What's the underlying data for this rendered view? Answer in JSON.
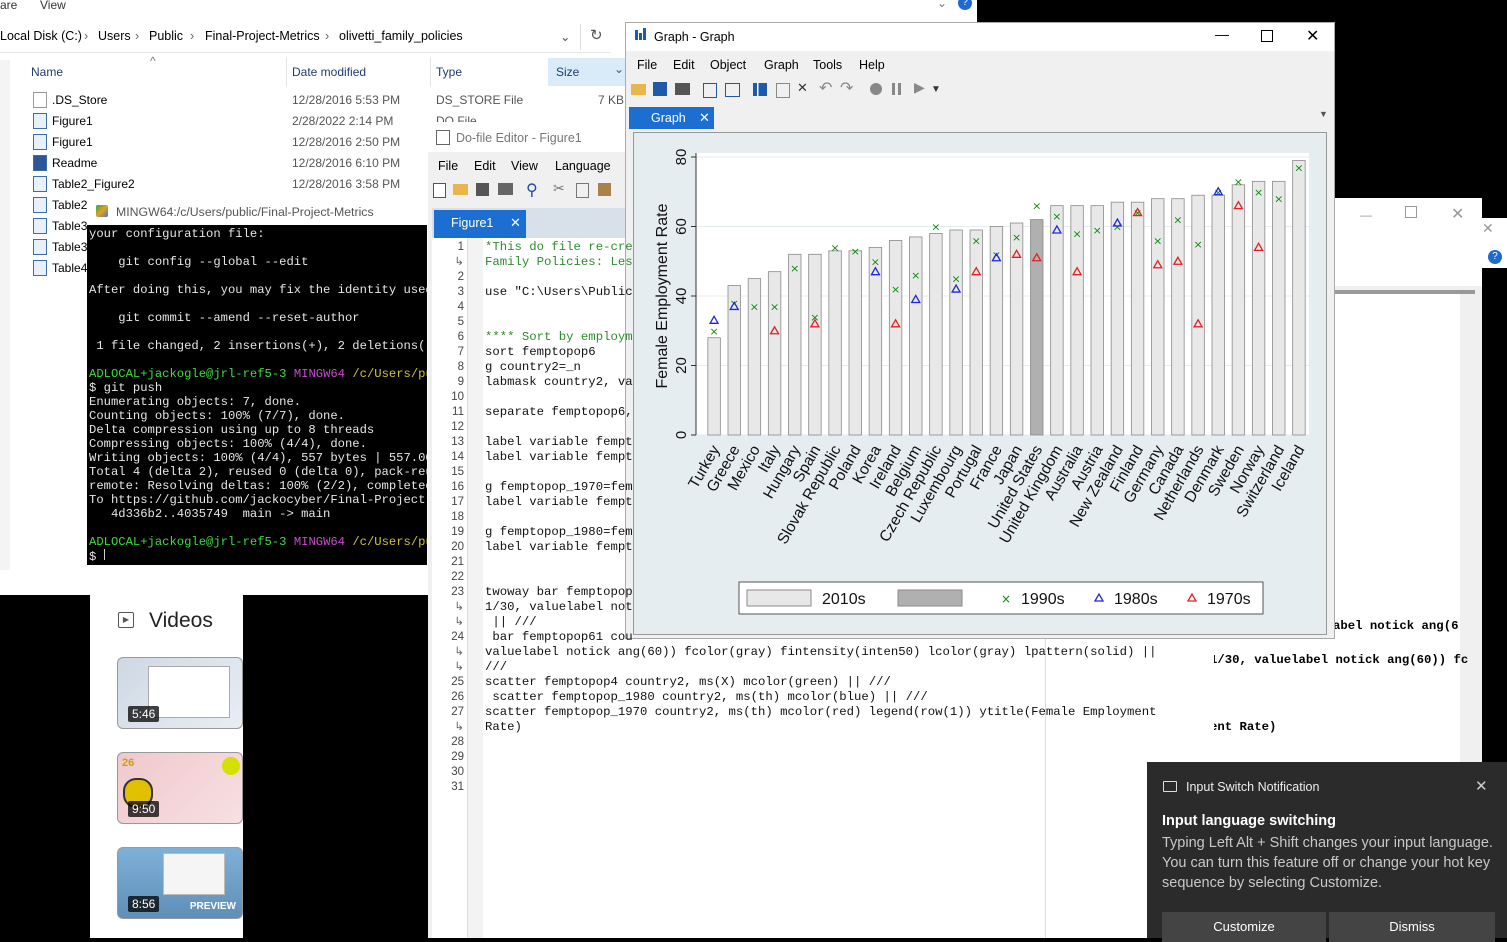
{
  "explorer": {
    "menu": [
      "are",
      "View"
    ],
    "address": [
      "Local Disk (C:)",
      "Users",
      "Public",
      "Final-Project-Metrics",
      "olivetti_family_policies"
    ],
    "columns": {
      "name": "Name",
      "date": "Date modified",
      "type": "Type",
      "size": "Size"
    },
    "files": [
      {
        "name": ".DS_Store",
        "date": "12/28/2016 5:53 PM",
        "type": "DS_STORE File",
        "size": "7 KB"
      },
      {
        "name": "Figure1",
        "date": "2/28/2022 2:14 PM",
        "type": "DO File",
        "size": ""
      },
      {
        "name": "Figure1",
        "date": "12/28/2016 2:50 PM",
        "type": "",
        "size": ""
      },
      {
        "name": "Readme",
        "date": "12/28/2016 6:10 PM",
        "type": "",
        "size": ""
      },
      {
        "name": "Table2_Figure2",
        "date": "12/28/2016 3:58 PM",
        "type": "",
        "size": ""
      },
      {
        "name": "Table2",
        "date": "",
        "type": "",
        "size": ""
      },
      {
        "name": "Table3",
        "date": "",
        "type": "",
        "size": ""
      },
      {
        "name": "Table3",
        "date": "",
        "type": "",
        "size": ""
      },
      {
        "name": "Table4",
        "date": "",
        "type": "",
        "size": ""
      }
    ]
  },
  "git": {
    "title": "MINGW64:/c/Users/public/Final-Project-Metrics",
    "lines": [
      "your configuration file:",
      "",
      "    git config --global --edit",
      "",
      "After doing this, you may fix the identity used",
      "",
      "    git commit --amend --reset-author",
      "",
      " 1 file changed, 2 insertions(+), 2 deletions(-)",
      ""
    ],
    "prompt_user": "ADLOCAL+jackogle@jrl-ref5-3",
    "prompt_env": "MINGW64",
    "prompt_path": "/c/Users/pub",
    "cmd": "$ git push",
    "push_lines": [
      "Enumerating objects: 7, done.",
      "Counting objects: 100% (7/7), done.",
      "Delta compression using up to 8 threads",
      "Compressing objects: 100% (4/4), done.",
      "Writing objects: 100% (4/4), 557 bytes | 557.00",
      "Total 4 (delta 2), reused 0 (delta 0), pack-reus",
      "remote: Resolving deltas: 100% (2/2), completed",
      "To https://github.com/jackocyber/Final-Project-M",
      "   4d336b2..4035749  main -> main"
    ],
    "last_prompt": "$"
  },
  "editor": {
    "title": "Do-file Editor - Figure1",
    "menu": [
      "File",
      "Edit",
      "View",
      "Language"
    ],
    "tab": "Figure1",
    "line_numbers": [
      "1",
      "",
      "2",
      "3",
      "4",
      "5",
      "6",
      "7",
      "8",
      "9",
      "10",
      "11",
      "12",
      "13",
      "14",
      "15",
      "16",
      "17",
      "18",
      "19",
      "20",
      "21",
      "22",
      "23",
      "",
      "",
      "24",
      "",
      "",
      "25",
      "26",
      "27",
      "",
      "28",
      "29",
      "30",
      "31"
    ],
    "code": [
      "*This do file re-cre",
      "Family Policies: Les",
      "",
      "use \"C:\\Users\\Public",
      "",
      "",
      "**** Sort by employm",
      "sort femptopop6",
      "g country2=_n",
      "labmask country2, va",
      "",
      "separate femptopop6,",
      "",
      "label variable fempt",
      "label variable fempt",
      "",
      "g femptopop_1970=fem",
      "label variable fempt",
      "",
      "g femptopop_1980=fem",
      "label variable fempt",
      "",
      "",
      "twoway bar femptopop",
      "1/30, valuelabel not",
      " || ///",
      " bar femptopop61 cou",
      "valuelabel notick ang(60)) fcolor(gray) fintensity(inten50) lcolor(gray) lpattern(solid) ||",
      "///",
      "scatter femptopop4 country2, ms(X) mcolor(green) || ///",
      " scatter femptopop_1980 country2, ms(th) mcolor(blue) || ///",
      "scatter femptopop_1970 country2, ms(th) mcolor(red) legend(row(1)) ytitle(Female Employment",
      "Rate)",
      "",
      "",
      "",
      ""
    ]
  },
  "graph": {
    "title": "Graph - Graph",
    "menu": [
      "File",
      "Edit",
      "Object",
      "Graph",
      "Tools",
      "Help"
    ],
    "tab": "Graph"
  },
  "chart_data": {
    "type": "bar",
    "ylabel": "Female Employment Rate",
    "ylim": [
      0,
      80
    ],
    "yticks": [
      "0",
      "20",
      "40",
      "60",
      "80"
    ],
    "categories": [
      "Turkey",
      "Greece",
      "Mexico",
      "Italy",
      "Hungary",
      "Spain",
      "Slovak Republic",
      "Poland",
      "Korea",
      "Ireland",
      "Belgium",
      "Czech Republic",
      "Luxembourg",
      "Portugal",
      "France",
      "Japan",
      "United States",
      "United Kingdom",
      "Australia",
      "Austria",
      "New Zealand",
      "Finland",
      "Germany",
      "Canada",
      "Netherlands",
      "Denmark",
      "Sweden",
      "Norway",
      "Switzerland",
      "Iceland"
    ],
    "series": [
      {
        "name": "2010s",
        "values": [
          28,
          43,
          45,
          47,
          52,
          52,
          53,
          53,
          54,
          56,
          57,
          58,
          59,
          59,
          60,
          61,
          62,
          66,
          66,
          66,
          67,
          67,
          68,
          68,
          69,
          69,
          72,
          73,
          73,
          79
        ]
      },
      {
        "name": "1990s",
        "values": [
          30,
          38,
          37,
          37,
          48,
          34,
          54,
          53,
          50,
          42,
          46,
          60,
          45,
          56,
          52,
          57,
          66,
          63,
          58,
          59,
          60,
          64,
          56,
          62,
          55,
          70,
          73,
          70,
          68,
          77
        ]
      },
      {
        "name": "1980s",
        "values": [
          33,
          37,
          null,
          null,
          null,
          null,
          null,
          null,
          47,
          null,
          39,
          null,
          42,
          null,
          51,
          null,
          null,
          59,
          null,
          null,
          61,
          null,
          null,
          null,
          null,
          70,
          null,
          null,
          null,
          null
        ]
      },
      {
        "name": "1970s",
        "values": [
          null,
          null,
          null,
          30,
          null,
          32,
          null,
          null,
          null,
          32,
          null,
          null,
          null,
          47,
          null,
          52,
          51,
          null,
          47,
          null,
          null,
          64,
          49,
          50,
          32,
          null,
          66,
          54,
          null,
          null
        ]
      }
    ],
    "highlight_category": "United States",
    "legend": [
      "2010s",
      "1990s",
      "1980s",
      "1970s"
    ],
    "legend_position": "bottom",
    "colors": {
      "bar": "#e8e8e8",
      "bar_highlight": "#b0b0b0",
      "1990s": "#0a8a0a",
      "1980s": "#1e28d8",
      "1970s": "#e02020"
    }
  },
  "rwin": {
    "code_lines": [
      "abel notick ang(6",
      "1/30, valuelabel notick ang(60)) fc",
      "",
      "",
      "ent Rate)"
    ]
  },
  "youtube": {
    "section_title": "Videos",
    "videos": [
      {
        "duration": "5:46",
        "badge": ""
      },
      {
        "duration": "9:50",
        "badge": "26"
      },
      {
        "duration": "8:56",
        "badge": "PREVIEW"
      }
    ]
  },
  "notification": {
    "app": "Input Switch Notification",
    "title": "Input language switching",
    "body": "Typing Left Alt + Shift changes your input language. You can turn this feature off or change your hot key sequence by selecting Customize.",
    "buttons": [
      "Customize",
      "Dismiss"
    ]
  }
}
